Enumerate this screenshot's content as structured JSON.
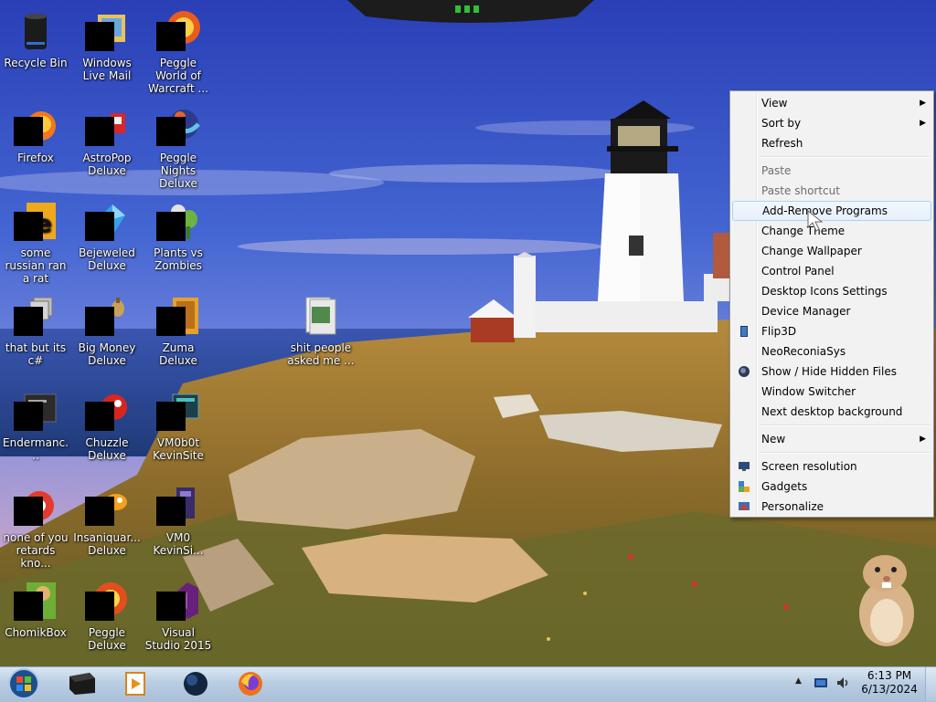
{
  "desktop": {
    "icons": [
      {
        "label": "Recycle Bin",
        "icon": "recycle-bin-icon",
        "redacted": false
      },
      {
        "label": "Windows Live Mail",
        "icon": "mail-icon",
        "redacted": true
      },
      {
        "label": "Peggle World of Warcraft ...",
        "icon": "peggle-icon",
        "redacted": true
      },
      {
        "label": "Firefox",
        "icon": "firefox-icon",
        "redacted": true
      },
      {
        "label": "AstroPop Deluxe",
        "icon": "game-icon",
        "redacted": true
      },
      {
        "label": "Peggle Nights Deluxe",
        "icon": "peggle-icon",
        "redacted": true
      },
      {
        "label": "some russian ran a rat",
        "icon": "shortcut-icon",
        "redacted": true
      },
      {
        "label": "Bejeweled Deluxe",
        "icon": "bejeweled-icon",
        "redacted": true
      },
      {
        "label": "Plants vs Zombies",
        "icon": "plant-icon",
        "redacted": true
      },
      {
        "label": "that but its c#",
        "icon": "window-icon",
        "redacted": true
      },
      {
        "label": "Big Money Deluxe",
        "icon": "money-icon",
        "redacted": true
      },
      {
        "label": "Zuma Deluxe",
        "icon": "zuma-icon",
        "redacted": true
      },
      {
        "label": "shit people asked me ...",
        "icon": "folder-icon",
        "redacted": false
      },
      {
        "label": "Endermanc...",
        "icon": "window-icon",
        "redacted": true
      },
      {
        "label": "Chuzzle Deluxe",
        "icon": "chuzzle-icon",
        "redacted": true
      },
      {
        "label": "VM0b0t KevinSite",
        "icon": "vm-icon",
        "redacted": true
      },
      {
        "label": "none of you retards kno...",
        "icon": "chrome-icon",
        "redacted": true
      },
      {
        "label": "Insaniquar... Deluxe",
        "icon": "fish-icon",
        "redacted": true
      },
      {
        "label": "VM0 KevinSi...",
        "icon": "vm-icon",
        "redacted": true
      },
      {
        "label": "ChomikBox",
        "icon": "chomik-icon",
        "redacted": true
      },
      {
        "label": "Peggle Deluxe",
        "icon": "peggle-icon",
        "redacted": true
      },
      {
        "label": "Visual Studio 2015",
        "icon": "visual-studio-icon",
        "redacted": true
      }
    ]
  },
  "context_menu": {
    "items": [
      {
        "label": "View",
        "type": "submenu"
      },
      {
        "label": "Sort by",
        "type": "submenu"
      },
      {
        "label": "Refresh",
        "type": "item"
      },
      {
        "type": "separator"
      },
      {
        "label": "Paste",
        "type": "disabled"
      },
      {
        "label": "Paste shortcut",
        "type": "disabled"
      },
      {
        "label": "Add-Remove Programs",
        "type": "hover"
      },
      {
        "label": "Change Theme",
        "type": "item"
      },
      {
        "label": "Change Wallpaper",
        "type": "item"
      },
      {
        "label": "Control Panel",
        "type": "item"
      },
      {
        "label": "Desktop Icons Settings",
        "type": "item"
      },
      {
        "label": "Device Manager",
        "type": "item"
      },
      {
        "label": "Flip3D",
        "type": "item",
        "icon": "flip3d-icon"
      },
      {
        "label": "NeoReconiaSys",
        "type": "item"
      },
      {
        "label": "Show / Hide Hidden Files",
        "type": "item",
        "icon": "globe-icon"
      },
      {
        "label": "Window Switcher",
        "type": "item"
      },
      {
        "label": "Next desktop background",
        "type": "item"
      },
      {
        "type": "separator"
      },
      {
        "label": "New",
        "type": "submenu"
      },
      {
        "type": "separator"
      },
      {
        "label": "Screen resolution",
        "type": "item",
        "icon": "monitor-icon"
      },
      {
        "label": "Gadgets",
        "type": "item",
        "icon": "gadgets-icon"
      },
      {
        "label": "Personalize",
        "type": "item",
        "icon": "personalize-icon"
      }
    ]
  },
  "taskbar": {
    "pinned": [
      {
        "name": "start-orb-icon"
      },
      {
        "name": "app-box-icon"
      },
      {
        "name": "media-player-icon"
      },
      {
        "name": "globe-app-icon"
      },
      {
        "name": "firefox-icon"
      }
    ],
    "clock": {
      "time": "6:13 PM",
      "date": "6/13/2024"
    }
  },
  "colors": {
    "menu_bg": "#f2f2f2",
    "menu_hover_border": "#a8d2f7",
    "taskbar_top": "#d9e6f2",
    "taskbar_bottom": "#a9c0d9"
  }
}
